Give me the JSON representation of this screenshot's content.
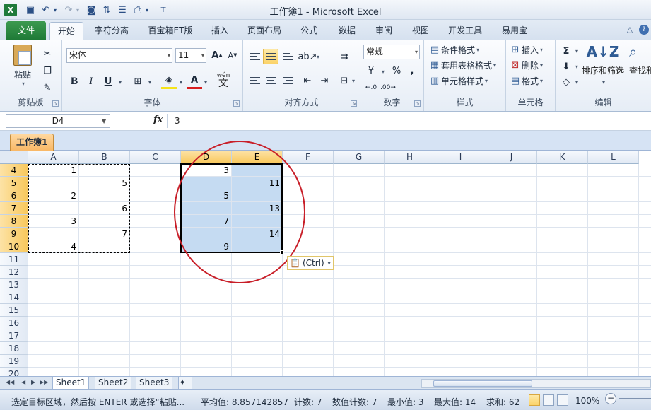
{
  "window": {
    "title": "工作簿1 - Microsoft Excel",
    "app_icon": "X",
    "quick_access": [
      "save-icon",
      "undo-icon",
      "redo-icon",
      "camera-icon",
      "sort-icon",
      "form-icon",
      "print-icon",
      "customize-icon"
    ]
  },
  "ribbon_tabs": [
    {
      "label": "文件"
    },
    {
      "label": "开始"
    },
    {
      "label": "字符分离"
    },
    {
      "label": "百宝箱ET版"
    },
    {
      "label": "插入"
    },
    {
      "label": "页面布局"
    },
    {
      "label": "公式"
    },
    {
      "label": "数据"
    },
    {
      "label": "审阅"
    },
    {
      "label": "视图"
    },
    {
      "label": "开发工具"
    },
    {
      "label": "易用宝"
    }
  ],
  "ribbon": {
    "clipboard": {
      "label": "剪贴板",
      "paste": "粘贴"
    },
    "font": {
      "label": "字体",
      "name": "宋体",
      "size": "11",
      "bold": "B",
      "italic": "I",
      "underline": "U",
      "wen": "wén",
      "wen_char": "文"
    },
    "alignment": {
      "label": "对齐方式"
    },
    "number": {
      "label": "数字",
      "format": "常规",
      "percent": "%",
      "comma": ","
    },
    "styles": {
      "label": "样式",
      "conditional": "条件格式",
      "table": "套用表格格式",
      "cell": "单元格样式"
    },
    "cells": {
      "label": "单元格",
      "insert": "插入",
      "delete": "删除",
      "format": "格式"
    },
    "editing": {
      "label": "编辑",
      "sort": "排序和筛选",
      "find": "查找和"
    }
  },
  "formula_bar": {
    "name_box": "D4",
    "fx": "fx",
    "value": "3"
  },
  "workbook_tab": "工作簿1",
  "grid": {
    "columns": [
      "A",
      "B",
      "C",
      "D",
      "E",
      "F",
      "G",
      "H",
      "I",
      "J",
      "K",
      "L"
    ],
    "rows": [
      "4",
      "5",
      "6",
      "7",
      "8",
      "9",
      "10",
      "11",
      "12",
      "13",
      "14",
      "15",
      "16",
      "17",
      "18",
      "19",
      "20"
    ],
    "selected_columns": [
      "D",
      "E"
    ],
    "selected_rows": [
      "4",
      "5",
      "6",
      "7",
      "8",
      "9",
      "10"
    ],
    "cells": [
      {
        "col": "A",
        "row": "4",
        "value": "1"
      },
      {
        "col": "B",
        "row": "5",
        "value": "5"
      },
      {
        "col": "A",
        "row": "6",
        "value": "2"
      },
      {
        "col": "B",
        "row": "7",
        "value": "6"
      },
      {
        "col": "A",
        "row": "8",
        "value": "3"
      },
      {
        "col": "B",
        "row": "9",
        "value": "7"
      },
      {
        "col": "A",
        "row": "10",
        "value": "4"
      },
      {
        "col": "D",
        "row": "4",
        "value": "3"
      },
      {
        "col": "E",
        "row": "5",
        "value": "11"
      },
      {
        "col": "D",
        "row": "6",
        "value": "5"
      },
      {
        "col": "E",
        "row": "7",
        "value": "13"
      },
      {
        "col": "D",
        "row": "8",
        "value": "7"
      },
      {
        "col": "E",
        "row": "9",
        "value": "14"
      },
      {
        "col": "D",
        "row": "10",
        "value": "9"
      }
    ],
    "paste_options": "(Ctrl)"
  },
  "sheets": [
    {
      "label": "Sheet1",
      "active": true
    },
    {
      "label": "Sheet2",
      "active": false
    },
    {
      "label": "Sheet3",
      "active": false
    }
  ],
  "status": {
    "message": "选定目标区域，然后按 ENTER 或选择“粘贴...",
    "average": "平均值: 8.857142857",
    "count": "计数: 7",
    "numeric_count": "数值计数: 7",
    "min": "最小值: 3",
    "max": "最大值: 14",
    "sum": "求和: 62",
    "zoom": "100%"
  },
  "colors": {
    "accent": "#1f7a37",
    "selection": "#c5dbf2",
    "header_selected": "#f8c85d",
    "annotation_circle": "#c81e28"
  }
}
